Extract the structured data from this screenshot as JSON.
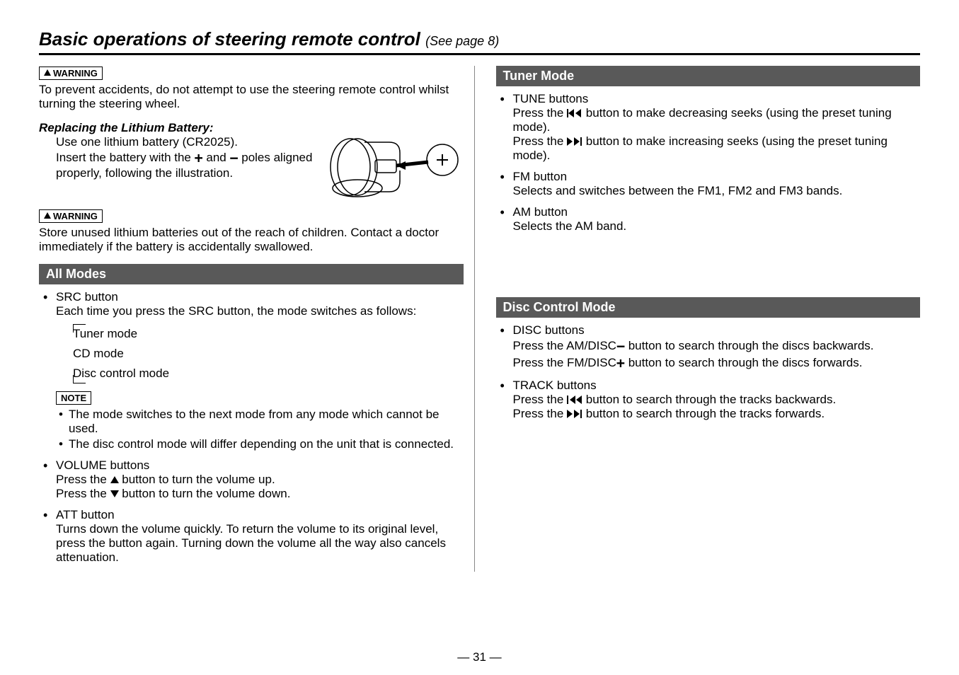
{
  "title": "Basic operations of steering remote control",
  "title_sub": "(See page 8)",
  "warning_label": "WARNING",
  "note_label": "NOTE",
  "left": {
    "warning1_text": "To prevent accidents, do not attempt to use the steering remote control whilst turning the steering wheel.",
    "replacing_heading": "Replacing the Lithium Battery:",
    "replacing_l1": "Use one lithium battery (CR2025).",
    "replacing_l2a": "Insert the battery with the ",
    "replacing_l2b": " and ",
    "replacing_l2c": " poles aligned properly, following the illustration.",
    "warning2_text": "Store unused lithium batteries out of the reach of children. Contact a doctor immediately if the battery is accidentally swallowed.",
    "all_modes_header": "All Modes",
    "src_title": "SRC button",
    "src_body": "Each time you press the SRC button, the mode switches as follows:",
    "mode1": "Tuner mode",
    "mode2": "CD mode",
    "mode3": "Disc control mode",
    "note1": "The mode switches to the next mode from any mode which cannot be used.",
    "note2": "The disc control mode will differ depending on the unit that is connected.",
    "vol_title": "VOLUME buttons",
    "vol_l1a": "Press the ",
    "vol_l1b": " button to turn the volume up.",
    "vol_l2a": "Press the ",
    "vol_l2b": " button to turn the volume down.",
    "att_title": "ATT button",
    "att_body": "Turns down the volume quickly. To return the volume to its original level, press the button again. Turning down the volume all the way also cancels attenuation."
  },
  "right": {
    "tuner_header": "Tuner Mode",
    "tune_title": "TUNE buttons",
    "tune_l1a": "Press the ",
    "tune_l1b": " button to make decreasing seeks (using the preset tuning mode).",
    "tune_l2a": "Press the ",
    "tune_l2b": " button to make increasing seeks (using the preset tuning mode).",
    "fm_title": "FM button",
    "fm_body": "Selects and switches between the FM1, FM2 and FM3 bands.",
    "am_title": "AM button",
    "am_body": "Selects the AM band.",
    "disc_header": "Disc Control Mode",
    "disc_title": "DISC buttons",
    "disc_l1a": "Press the AM/DISC",
    "disc_l1b": " button to search through the discs backwards.",
    "disc_l2a": "Press the FM/DISC",
    "disc_l2b": " button to search through the discs forwards.",
    "track_title": "TRACK buttons",
    "track_l1a": "Press the ",
    "track_l1b": " button to search through the tracks backwards.",
    "track_l2a": "Press the ",
    "track_l2b": " button to search through the tracks forwards."
  },
  "page_number": "31"
}
